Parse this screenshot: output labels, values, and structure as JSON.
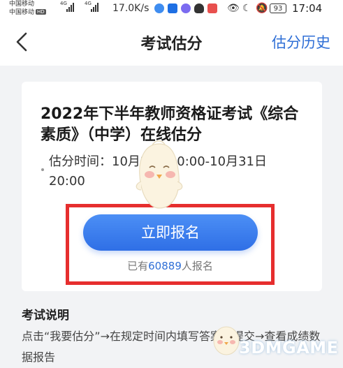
{
  "status_bar": {
    "carrier_1": "中国移动",
    "carrier_2": "中国移动",
    "hd_badge": "HD",
    "network_1": "4G",
    "network_2": "4G",
    "speed": "17.0K/s",
    "battery": "93",
    "time": "17:04"
  },
  "nav": {
    "title": "考试估分",
    "history_label": "估分历史"
  },
  "card": {
    "exam_title": "2022年下半年教师资格证考试《综合素质》（中学）在线估分",
    "time_label": "估分时间：",
    "time_value": "10月29日20:00-10月31日 20:00",
    "enroll_button": "立即报名",
    "enroll_prefix": "已有",
    "enroll_count": "60889",
    "enroll_suffix": "人报名"
  },
  "notes": {
    "title": "考试说明",
    "body": "点击“我要估分”→在规定时间内填写答案并提交→查看成绩数据报告"
  },
  "watermark": {
    "text": "3DMGAME"
  },
  "colors": {
    "accent": "#2f6fd6",
    "button": "#3a7ef0",
    "highlight_box": "#e62e2e"
  }
}
